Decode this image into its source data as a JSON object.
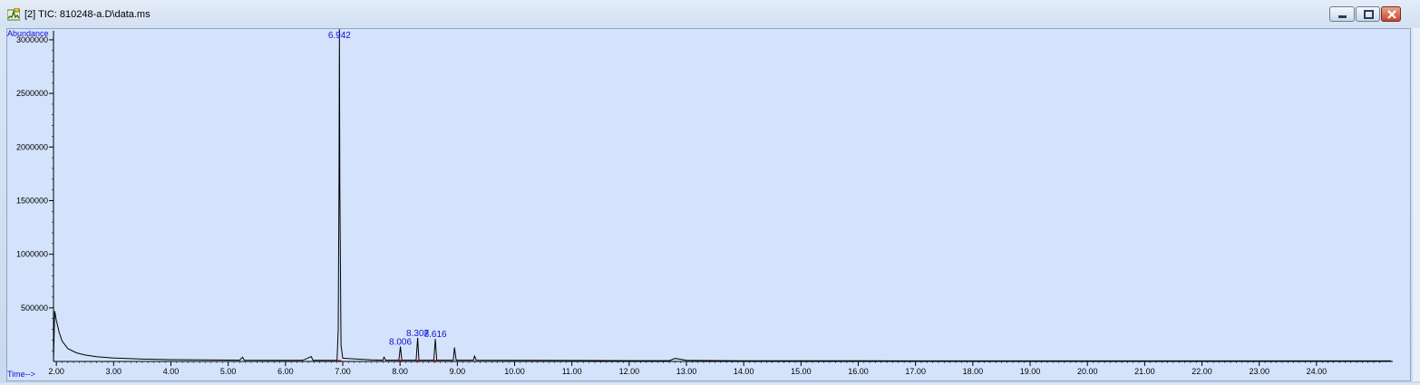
{
  "window": {
    "title": "[2] TIC: 810248-a.D\\data.ms",
    "icon": "chromatogram-app-icon"
  },
  "chart_data": {
    "type": "line",
    "ylabel": "Abundance",
    "xlabel": "Time-->",
    "xlim": [
      1.95,
      25.3
    ],
    "ylim": [
      0,
      3050000
    ],
    "x_ticks": [
      "2.00",
      "3.00",
      "4.00",
      "5.00",
      "6.00",
      "7.00",
      "8.00",
      "9.00",
      "10.00",
      "11.00",
      "12.00",
      "13.00",
      "14.00",
      "15.00",
      "16.00",
      "17.00",
      "18.00",
      "19.00",
      "20.00",
      "21.00",
      "22.00",
      "23.00",
      "24.00"
    ],
    "x_tick_values": [
      2,
      3,
      4,
      5,
      6,
      7,
      8,
      9,
      10,
      11,
      12,
      13,
      14,
      15,
      16,
      17,
      18,
      19,
      20,
      21,
      22,
      23,
      24
    ],
    "y_ticks": [
      "500000",
      "1000000",
      "1500000",
      "2000000",
      "2500000",
      "3000000"
    ],
    "y_tick_values": [
      500000,
      1000000,
      1500000,
      2000000,
      2500000,
      3000000
    ],
    "peak_labels": [
      {
        "text": "6.942",
        "x": 6.942,
        "y": 3000000
      },
      {
        "text": "8.006",
        "x": 8.006,
        "y": 140000
      },
      {
        "text": "8.307",
        "x": 8.307,
        "y": 220000
      },
      {
        "text": "8.616",
        "x": 8.616,
        "y": 210000
      }
    ],
    "series": [
      {
        "color": "#000000",
        "points": [
          [
            1.95,
            0
          ],
          [
            1.97,
            470000
          ],
          [
            2.0,
            380000
          ],
          [
            2.05,
            270000
          ],
          [
            2.1,
            190000
          ],
          [
            2.2,
            120000
          ],
          [
            2.35,
            80000
          ],
          [
            2.5,
            60000
          ],
          [
            2.7,
            45000
          ],
          [
            3.0,
            32000
          ],
          [
            3.5,
            22000
          ],
          [
            4.0,
            17000
          ],
          [
            5.0,
            13000
          ],
          [
            5.2,
            12000
          ],
          [
            5.25,
            40000
          ],
          [
            5.28,
            12000
          ],
          [
            6.0,
            11000
          ],
          [
            6.3,
            10000
          ],
          [
            6.45,
            45000
          ],
          [
            6.48,
            10000
          ],
          [
            6.9,
            10000
          ],
          [
            6.92,
            300000
          ],
          [
            6.935,
            1700000
          ],
          [
            6.942,
            3100000
          ],
          [
            6.95,
            1600000
          ],
          [
            6.97,
            150000
          ],
          [
            7.0,
            30000
          ],
          [
            7.5,
            15000
          ],
          [
            7.7,
            12000
          ],
          [
            7.72,
            40000
          ],
          [
            7.75,
            12000
          ],
          [
            7.98,
            12000
          ],
          [
            8.006,
            140000
          ],
          [
            8.03,
            12000
          ],
          [
            8.28,
            12000
          ],
          [
            8.307,
            220000
          ],
          [
            8.33,
            12000
          ],
          [
            8.59,
            12000
          ],
          [
            8.616,
            210000
          ],
          [
            8.64,
            12000
          ],
          [
            8.93,
            12000
          ],
          [
            8.95,
            130000
          ],
          [
            8.98,
            12000
          ],
          [
            9.28,
            12000
          ],
          [
            9.3,
            50000
          ],
          [
            9.33,
            12000
          ],
          [
            10.0,
            10000
          ],
          [
            11.0,
            9000
          ],
          [
            12.0,
            8000
          ],
          [
            12.7,
            8000
          ],
          [
            12.8,
            28000
          ],
          [
            12.9,
            20000
          ],
          [
            13.0,
            10000
          ],
          [
            14.0,
            7000
          ],
          [
            16.0,
            6000
          ],
          [
            18.0,
            5000
          ],
          [
            20.0,
            5000
          ],
          [
            22.0,
            5000
          ],
          [
            24.0,
            5000
          ],
          [
            25.3,
            5000
          ]
        ]
      }
    ]
  },
  "colors": {
    "plot_bg": "#d4e3fb",
    "axis": "#000000",
    "label_blue": "#1010d0",
    "integration_red": "#cc0000"
  }
}
